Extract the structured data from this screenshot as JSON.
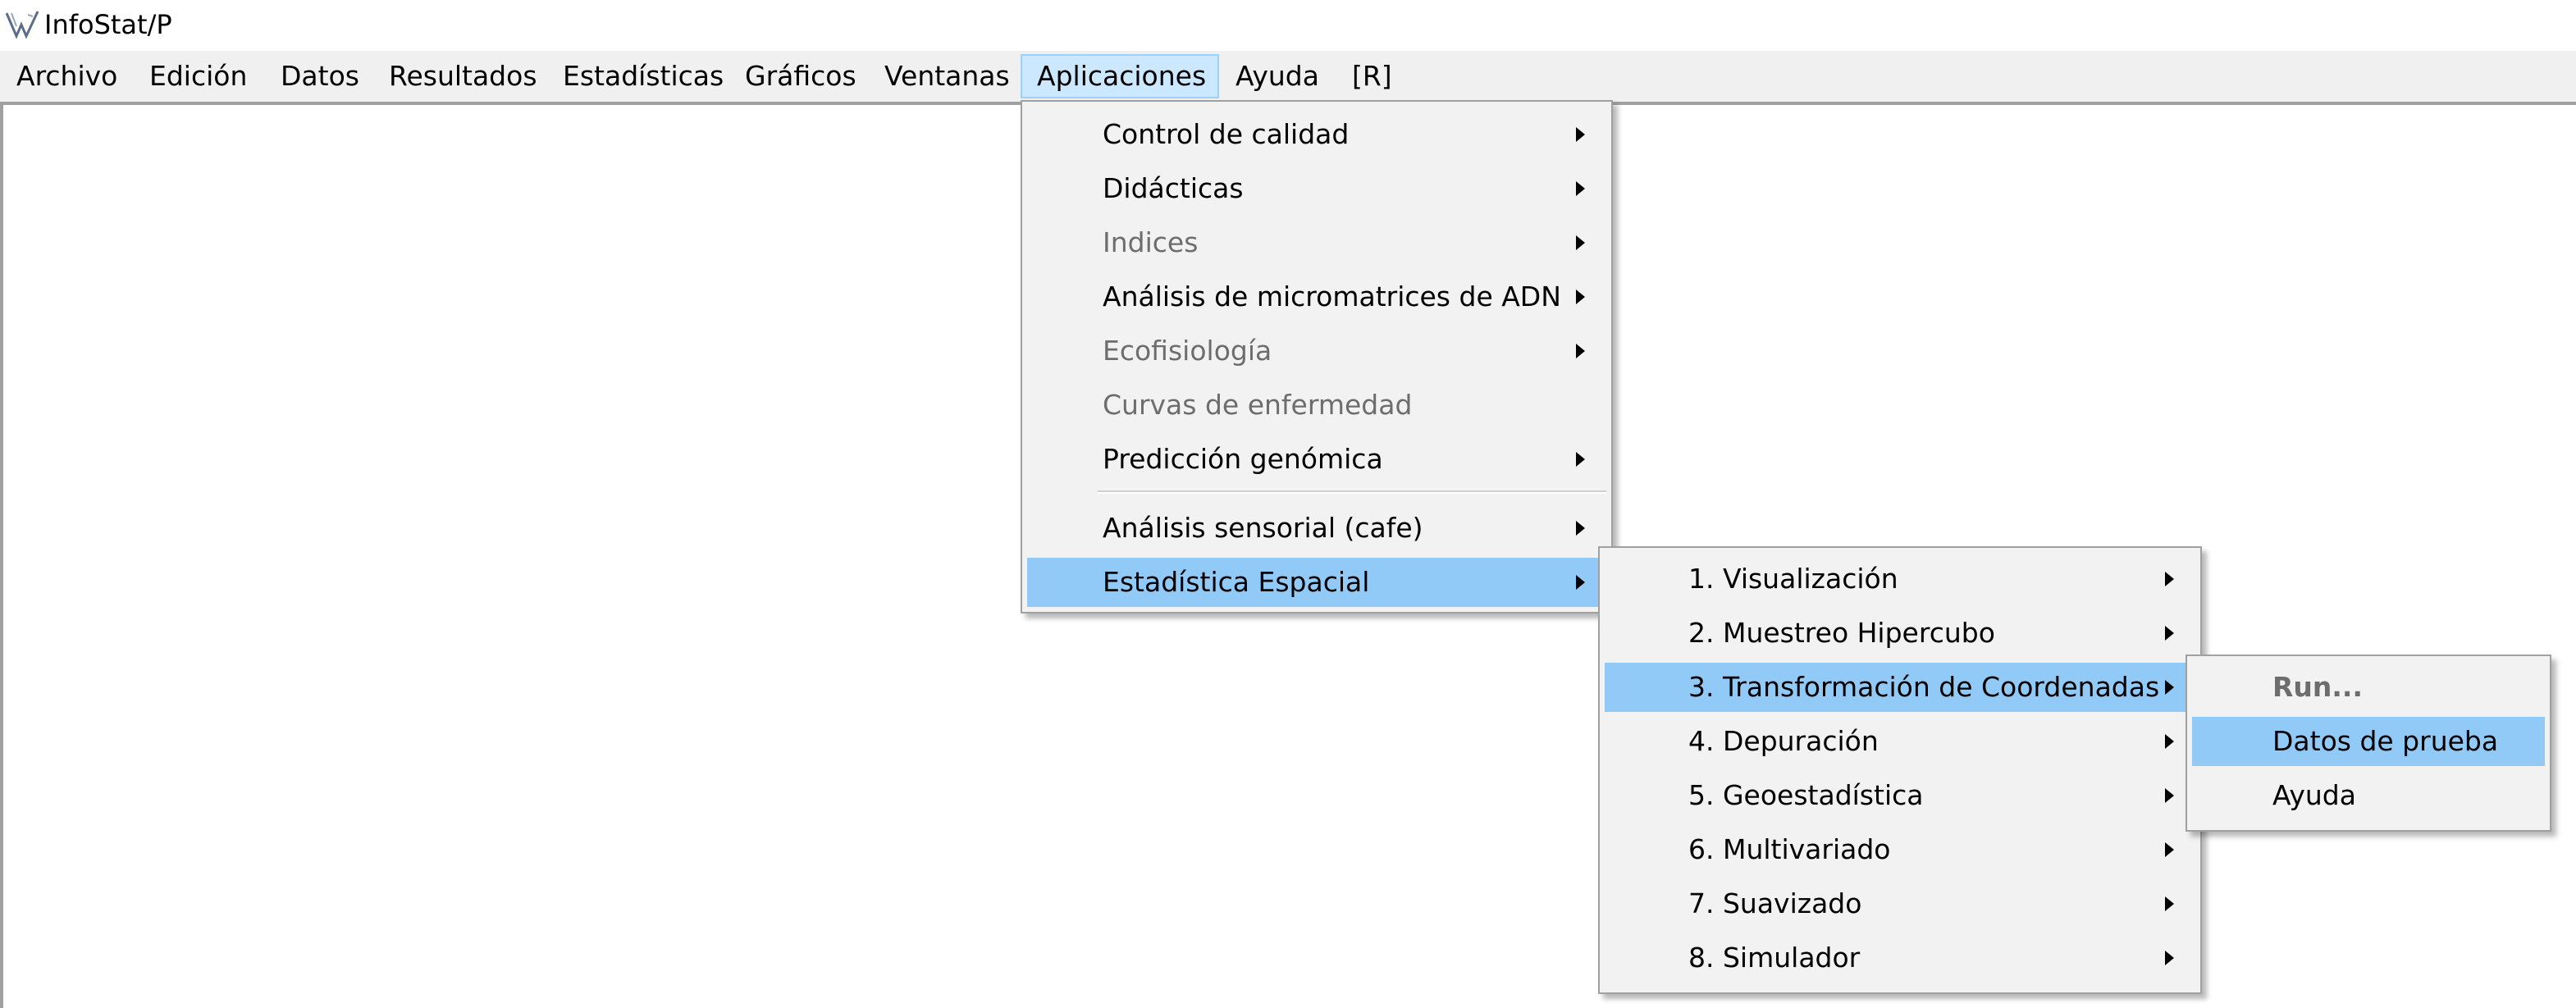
{
  "window": {
    "title": "InfoStat/P",
    "icon": "infostat-logo-icon"
  },
  "menubar": {
    "items": [
      {
        "label": "Archivo"
      },
      {
        "label": "Edición"
      },
      {
        "label": "Datos"
      },
      {
        "label": "Resultados"
      },
      {
        "label": "Estadísticas"
      },
      {
        "label": "Gráficos"
      },
      {
        "label": "Ventanas"
      },
      {
        "label": "Aplicaciones",
        "active": true
      },
      {
        "label": "Ayuda"
      },
      {
        "label": "[R]"
      }
    ]
  },
  "aplicaciones_menu": {
    "items": [
      {
        "label": "Control de calidad",
        "submenu": true,
        "enabled": true
      },
      {
        "label": "Didácticas",
        "submenu": true,
        "enabled": true
      },
      {
        "label": "Indices",
        "submenu": true,
        "enabled": false
      },
      {
        "label": "Análisis de micromatrices de ADN",
        "submenu": true,
        "enabled": true
      },
      {
        "label": "Ecofisiología",
        "submenu": true,
        "enabled": false
      },
      {
        "label": "Curvas de enfermedad",
        "submenu": false,
        "enabled": false
      },
      {
        "label": "Predicción genómica",
        "submenu": true,
        "enabled": true
      },
      {
        "label": "Análisis sensorial (cafe)",
        "submenu": true,
        "enabled": true
      },
      {
        "label": "Estadística Espacial",
        "submenu": true,
        "enabled": true,
        "highlighted": true
      }
    ]
  },
  "espacial_menu": {
    "items": [
      {
        "label": "1. Visualización",
        "submenu": true
      },
      {
        "label": "2. Muestreo Hipercubo",
        "submenu": true
      },
      {
        "label": "3. Transformación de Coordenadas",
        "submenu": true,
        "highlighted": true
      },
      {
        "label": "4. Depuración",
        "submenu": true
      },
      {
        "label": "5. Geoestadística",
        "submenu": true
      },
      {
        "label": "6. Multivariado",
        "submenu": true
      },
      {
        "label": "7. Suavizado",
        "submenu": true
      },
      {
        "label": "8. Simulador",
        "submenu": true
      }
    ]
  },
  "coordenadas_menu": {
    "items": [
      {
        "label": "Run...",
        "enabled": false
      },
      {
        "label": "Datos de prueba",
        "highlighted": true
      },
      {
        "label": "Ayuda"
      }
    ]
  },
  "colors": {
    "highlight": "#91c9f7",
    "menu_bg": "#f2f2f2",
    "menubar_active": "#cce8ff",
    "disabled_text": "#6d6d6d"
  }
}
